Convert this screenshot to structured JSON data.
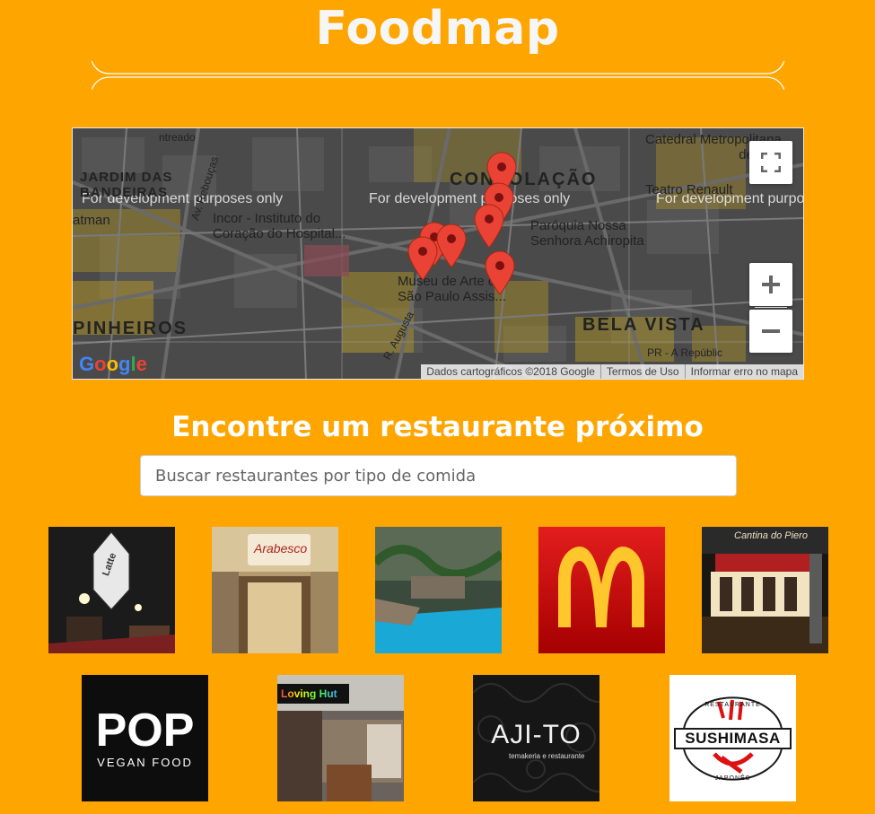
{
  "header": {
    "title": "Foodmap"
  },
  "map": {
    "watermark": "For development purposes only",
    "places": {
      "jardim": "JARDIM DAS\nBANDEIRAS",
      "consolacao": "CONSOLAÇÃO",
      "pinheiros": "PINHEIROS",
      "bela_vista": "BELA VISTA",
      "catedral": "Catedral Metropolitana\nde São",
      "teatro": "Teatro Renault",
      "paroquia": "Paróquia Nossa\nSenhora Achiropita",
      "incor": "Incor - Instituto do\nCoração do Hospital...",
      "museu": "Museu de Arte de\nSão Paulo Assis...",
      "ramen": "atman",
      "entreado": "ntreado",
      "av_rebou": "Av. Rebouças",
      "r_augusta": "R. Augusta",
      "pr_a_repub": "PR - A Repúblic"
    },
    "attribution": [
      "Dados cartográficos ©2018 Google",
      "Termos de Uso",
      "Informar erro no mapa"
    ],
    "google_logo": "Google",
    "colors": {
      "pin": "#ea4335",
      "road": "#c9a21a"
    }
  },
  "finder": {
    "heading": "Encontre um restaurante próximo",
    "search_placeholder": "Buscar restaurantes por tipo de comida"
  },
  "restaurants": {
    "row1": [
      "latte-icon",
      "arabesco-icon",
      "pool-restaurant-icon",
      "mcdonalds-icon",
      "cantina-icon"
    ],
    "row2": [
      "pop-vegan-icon",
      "loving-hut-icon",
      "aji-to-icon",
      "sushimasa-icon"
    ],
    "labels": {
      "latte": "Latte",
      "arabesco": "Arabesco",
      "cantina": "Cantina do Piero",
      "pop": "POP",
      "pop_sub": "VEGAN FOOD",
      "loving": "Loving Hut",
      "ajito": "AJI-TO",
      "ajito_sub": "temakeria e restaurante",
      "sushimasa": "SUSHIMASA",
      "sushimasa_top": "RESTAURANTE",
      "sushimasa_bottom": "JAPONÊS"
    }
  }
}
